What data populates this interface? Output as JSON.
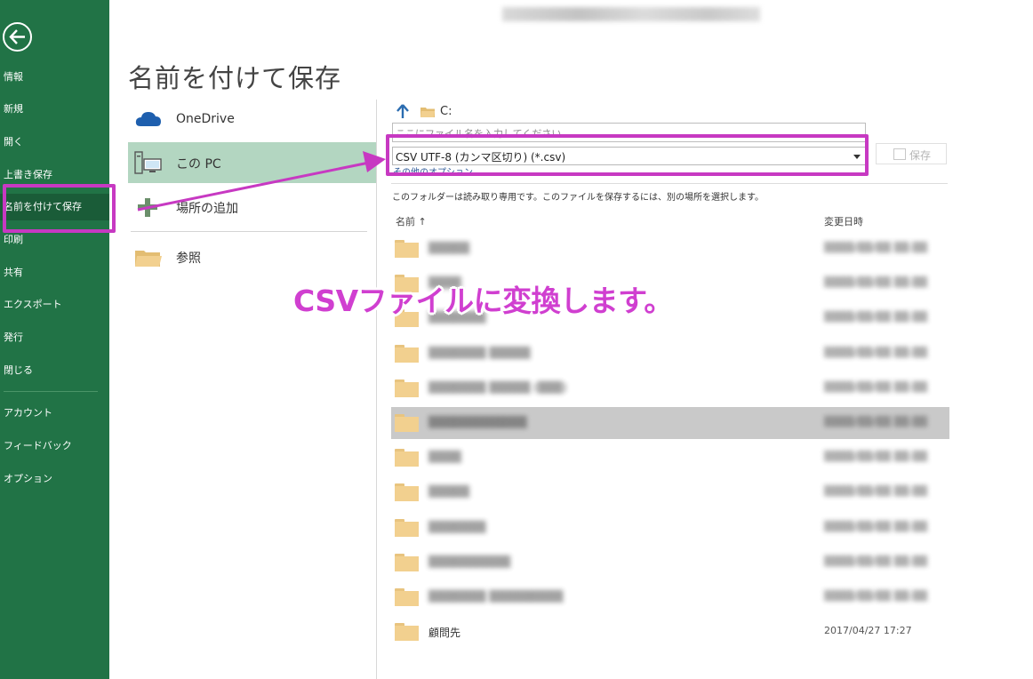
{
  "window": {
    "title": "▒▒▒▒▒▒▒▒ ▒▒▒▒▒▒▒▒▒ ▒▒▒▒ ▒ ▒ ▒▒▒▒"
  },
  "nav": {
    "back_icon": "arrow-left-circle-icon",
    "items": [
      {
        "label": "情報",
        "selected": false
      },
      {
        "label": "新規",
        "selected": false
      },
      {
        "label": "開く",
        "selected": false
      },
      {
        "label": "上書き保存",
        "selected": false
      },
      {
        "label": "名前を付けて保存",
        "selected": true
      },
      {
        "label": "印刷",
        "selected": false
      },
      {
        "label": "共有",
        "selected": false
      },
      {
        "label": "エクスポート",
        "selected": false
      },
      {
        "label": "発行",
        "selected": false
      },
      {
        "label": "閉じる",
        "selected": false
      }
    ],
    "bottom_items": [
      {
        "label": "アカウント"
      },
      {
        "label": "フィードバック"
      },
      {
        "label": "オプション"
      }
    ],
    "accent_color": "#217346"
  },
  "page": {
    "title": "名前を付けて保存"
  },
  "locations": [
    {
      "label": "OneDrive",
      "icon": "onedrive-cloud-icon",
      "selected": false
    },
    {
      "label": "この PC",
      "icon": "this-pc-icon",
      "selected": true
    },
    {
      "label": "場所の追加",
      "icon": "plus-icon",
      "selected": false
    },
    {
      "label": "参照",
      "icon": "folder-browse-icon",
      "selected": false
    }
  ],
  "save_panel": {
    "path": "C:",
    "filename_placeholder": "ここにファイル名を入力してください",
    "filetype_value": "CSV UTF-8 (カンマ区切り) (*.csv)",
    "more_options": "その他のオプション...",
    "save_label": "保存",
    "readonly_message": "このフォルダーは読み取り専用です。このファイルを保存するには、別の場所を選択します。",
    "columns": {
      "name": "名前 ↑",
      "date": "変更日時"
    }
  },
  "folders": [
    {
      "name": "▒▒▒▒▒",
      "date": "▒▒▒▒/▒▒/▒▒ ▒▒:▒▒",
      "highlight": false,
      "blurred": true
    },
    {
      "name": "▒▒▒▒",
      "date": "▒▒▒▒/▒▒/▒▒ ▒▒:▒▒",
      "highlight": false,
      "blurred": true
    },
    {
      "name": "▒▒▒▒▒▒▒",
      "date": "▒▒▒▒/▒▒/▒▒ ▒▒:▒▒",
      "highlight": false,
      "blurred": true
    },
    {
      "name": "▒▒▒▒▒▒▒ ▒▒▒▒▒",
      "date": "▒▒▒▒/▒▒/▒▒ ▒▒:▒▒",
      "highlight": false,
      "blurred": true
    },
    {
      "name": "▒▒▒▒▒▒▒ ▒▒▒▒▒ (▒▒▒)",
      "date": "▒▒▒▒/▒▒/▒▒ ▒▒:▒▒",
      "highlight": false,
      "blurred": true
    },
    {
      "name": "▒▒▒▒▒▒▒▒▒▒▒▒",
      "date": "▒▒▒▒/▒▒/▒▒ ▒▒:▒▒",
      "highlight": true,
      "blurred": true
    },
    {
      "name": "▒▒▒▒",
      "date": "▒▒▒▒/▒▒/▒▒ ▒▒:▒▒",
      "highlight": false,
      "blurred": true
    },
    {
      "name": "▒▒▒▒▒",
      "date": "▒▒▒▒/▒▒/▒▒ ▒▒:▒▒",
      "highlight": false,
      "blurred": true
    },
    {
      "name": "▒▒▒▒▒▒▒",
      "date": "▒▒▒▒/▒▒/▒▒ ▒▒:▒▒",
      "highlight": false,
      "blurred": true
    },
    {
      "name": "▒▒▒▒▒▒▒▒▒▒",
      "date": "▒▒▒▒/▒▒/▒▒ ▒▒:▒▒",
      "highlight": false,
      "blurred": true
    },
    {
      "name": "▒▒▒▒▒▒▒ ▒▒▒▒▒▒▒▒▒",
      "date": "▒▒▒▒/▒▒/▒▒ ▒▒:▒▒",
      "highlight": false,
      "blurred": true
    },
    {
      "name": "顧問先",
      "date": "2017/04/27 17:27",
      "highlight": false,
      "blurred": false
    }
  ],
  "annotation": {
    "callout_text": "CSVファイルに変換します。",
    "color": "#c739c2"
  }
}
